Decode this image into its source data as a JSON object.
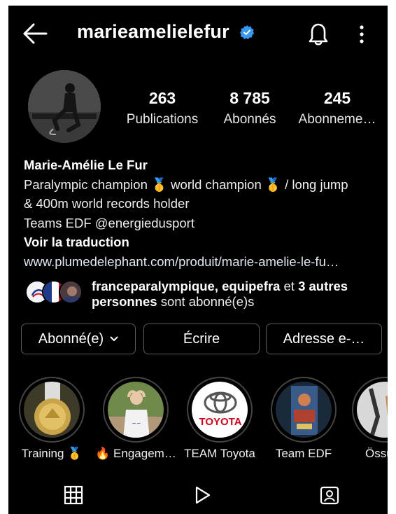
{
  "header": {
    "back_icon": "arrow-left-icon",
    "username": "marieamelielefur",
    "verified_icon": "verified-badge-icon",
    "bell_icon": "bell-icon",
    "more_icon": "more-vertical-icon"
  },
  "stats": [
    {
      "count": "263",
      "label": "Publications"
    },
    {
      "count": "8 785",
      "label": "Abonnés"
    },
    {
      "count": "245",
      "label": "Abonneme…"
    }
  ],
  "bio": {
    "name": "Marie-Amélie Le Fur",
    "line1_a": "Paralympic champion ",
    "medal": "🥇",
    "line1_b": " world champion ",
    "line1_c": " / long jump",
    "line2": "& 400m world records holder",
    "line3": "Teams EDF @energiedusport",
    "translate": "Voir la traduction",
    "link": "www.plumedelephant.com/produit/marie-amelie-le-fu…"
  },
  "followed_by": {
    "users": "franceparalympique, equipefra",
    "et": " et ",
    "others": "3 autres",
    "persons": "personnes",
    "suffix": " sont abonné(e)s"
  },
  "buttons": {
    "following": "Abonné(e)",
    "following_icon": "chevron-down-icon",
    "message": "Écrire",
    "email": "Adresse e-…"
  },
  "highlights": [
    {
      "label": "Training 🥇"
    },
    {
      "label": "🔥 Engagem…"
    },
    {
      "label": "TEAM Toyota",
      "logo_text": "TOYOTA"
    },
    {
      "label": "Team EDF"
    },
    {
      "label": "Össu"
    }
  ],
  "tabs": {
    "grid_icon": "grid-icon",
    "reels_icon": "reels-play-icon",
    "tagged_icon": "tagged-user-icon"
  },
  "colors": {
    "background": "#000000",
    "verified": "#3897f0",
    "border": "#5a5a5a"
  }
}
